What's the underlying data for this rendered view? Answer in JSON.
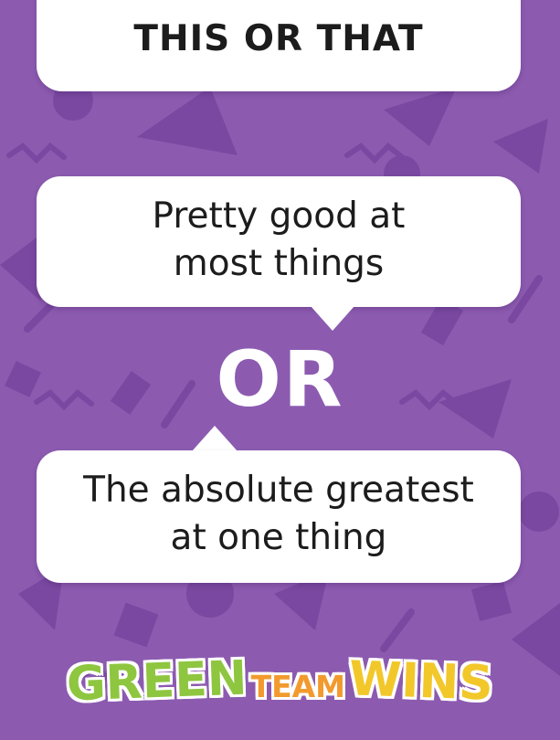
{
  "title": "THIS OR THAT",
  "option_a": {
    "line1": "Pretty good at",
    "line2": "most things"
  },
  "divider": "OR",
  "option_b": {
    "line1": "The absolute greatest",
    "line2": "at one thing"
  },
  "logo": {
    "word1": "GREEN",
    "word2": "TEAM",
    "word3": "WINS"
  },
  "colors": {
    "background": "#8c5bb0",
    "pattern": "#7a48a0",
    "card": "#ffffff",
    "logo_green": "#8ec63f",
    "logo_orange": "#f29a2e",
    "logo_yellow": "#f2c72a"
  }
}
